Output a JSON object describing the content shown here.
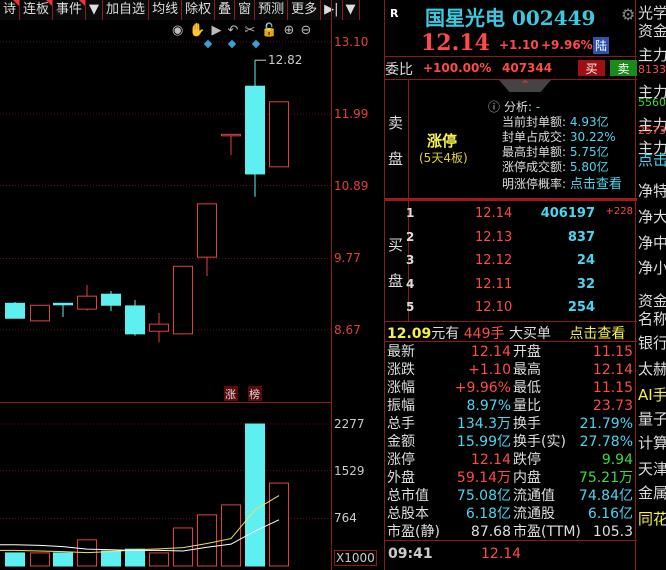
{
  "toolbar": {
    "items": [
      "诗",
      "连板",
      "事件",
      "▼",
      "加自选",
      "均线",
      "除权",
      "叠",
      "窗",
      "预测",
      "更多",
      "▶|",
      "▼"
    ]
  },
  "chart_tools": [
    "eye-icon",
    "hand-icon",
    "play-icon",
    "undo-icon",
    "scissors-icon",
    "lock-icon",
    "zoom-in-icon",
    "zoom-out-icon"
  ],
  "chart_data": [
    {
      "type": "candlestick",
      "title": "",
      "yticks": [
        "13.10",
        "11.99",
        "10.89",
        "9.77",
        "8.67"
      ],
      "ylim": [
        8.4,
        13.1
      ],
      "high_label": "12.82",
      "candles": [
        [
          9.08,
          9.1,
          8.85,
          8.85
        ],
        [
          8.81,
          9.05,
          8.8,
          9.05
        ],
        [
          9.08,
          9.08,
          8.87,
          9.08
        ],
        [
          8.99,
          9.36,
          8.97,
          9.19
        ],
        [
          9.22,
          9.27,
          8.96,
          9.05
        ],
        [
          9.04,
          9.13,
          8.58,
          8.61
        ],
        [
          8.65,
          8.93,
          8.48,
          8.76
        ],
        [
          8.61,
          9.65,
          8.6,
          9.65
        ],
        [
          9.79,
          10.61,
          9.5,
          10.61
        ],
        [
          11.68,
          11.68,
          11.36,
          11.68
        ],
        [
          12.42,
          12.82,
          10.72,
          11.07
        ],
        [
          11.18,
          12.18,
          11.18,
          12.18
        ]
      ],
      "markers": [
        "涨",
        "榜"
      ]
    },
    {
      "type": "bar",
      "title": "volume",
      "unit": "X1000",
      "yticks": [
        "2277",
        "1529",
        "764"
      ],
      "ylim": [
        0,
        2277
      ],
      "values": [
        210,
        210,
        210,
        420,
        240,
        270,
        210,
        610,
        820,
        980,
        2277,
        1330
      ],
      "up": [
        false,
        true,
        false,
        true,
        false,
        false,
        true,
        true,
        true,
        true,
        false,
        true
      ],
      "ma5": [
        250,
        240,
        230,
        215,
        230,
        260,
        275,
        295,
        360,
        440,
        900,
        1130
      ],
      "ma10": [
        340,
        330,
        310,
        270,
        260,
        250,
        250,
        240,
        300,
        350,
        560,
        740
      ]
    }
  ],
  "quote": {
    "badge": "R",
    "name": "国星光电 002449",
    "price": "12.14",
    "change": "+1.10",
    "pct": "+9.96%",
    "market": "陆",
    "weibi_label": "委比",
    "weibi": "+100.00%",
    "weicha": "407344",
    "buy": "买",
    "sell": "卖"
  },
  "sell_side": {
    "label1": "卖",
    "label2": "盘",
    "limit_up": "涨停",
    "streak": "(5天4板)",
    "analysis": [
      [
        "分析",
        "-"
      ],
      [
        "当前封单额",
        "4.93亿"
      ],
      [
        "封单占成交",
        "30.22%"
      ],
      [
        "最高封单额",
        "5.75亿"
      ],
      [
        "涨停成交额",
        "5.80亿"
      ],
      [
        "明涨停概率",
        "点击查看"
      ]
    ]
  },
  "buy_side": {
    "label1": "买",
    "label2": "盘",
    "rows": [
      [
        "1",
        "12.14",
        "406197",
        "+228"
      ],
      [
        "2",
        "12.13",
        "837",
        ""
      ],
      [
        "3",
        "12.12",
        "24",
        ""
      ],
      [
        "4",
        "12.11",
        "32",
        ""
      ],
      [
        "5",
        "12.10",
        "254",
        ""
      ]
    ]
  },
  "big_order": {
    "price": "12.09",
    "t1": "元有",
    "qty": "449手",
    "t2": "大买单",
    "link": "点击查看"
  },
  "stats": [
    [
      "最新",
      "12.14",
      "red",
      "开盘",
      "11.15",
      "red"
    ],
    [
      "涨跌",
      "+1.10",
      "red",
      "最高",
      "12.14",
      "red"
    ],
    [
      "涨幅",
      "+9.96%",
      "red",
      "最低",
      "11.15",
      "red"
    ],
    [
      "振幅",
      "8.97%",
      "cyan",
      "量比",
      "23.73",
      "red"
    ],
    [
      "总手",
      "134.3万",
      "cyan",
      "换手",
      "21.79%",
      "cyan"
    ],
    [
      "金额",
      "15.99亿",
      "cyan",
      "换手(实)",
      "27.78%",
      "cyan"
    ],
    [
      "涨停",
      "12.14",
      "red",
      "跌停",
      "9.94",
      "green"
    ],
    [
      "外盘",
      "59.14万",
      "red",
      "内盘",
      "75.21万",
      "green"
    ],
    [
      "总市值",
      "75.08亿",
      "cyan",
      "流通值",
      "74.84亿",
      "cyan"
    ],
    [
      "总股本",
      "6.18亿",
      "cyan",
      "流通股",
      "6.16亿",
      "cyan"
    ],
    [
      "市盈(静)",
      "87.68",
      "white",
      "市盈(TTM)",
      "105.3",
      "white"
    ]
  ],
  "tick": {
    "time": "09:41",
    "price": "12.14"
  },
  "far_right": [
    [
      "光学",
      "#ddd"
    ],
    [
      "资金",
      "#ddd"
    ],
    [
      "主力",
      "#ddd"
    ],
    [
      "8133",
      "#ff4a4a"
    ],
    [
      "主力",
      "#ddd"
    ],
    [
      "5560",
      "#3ddc3d"
    ],
    [
      "主力",
      "#ddd"
    ],
    [
      "2573",
      "#ff4a4a"
    ],
    [
      "主力",
      "#ddd"
    ],
    [
      "点击",
      "#4ad6f0"
    ],
    [
      "净特",
      "#ddd"
    ],
    [
      "净大",
      "#ddd"
    ],
    [
      "净中",
      "#ddd"
    ],
    [
      "净小",
      "#ddd"
    ],
    [
      "资金",
      "#ddd"
    ],
    [
      "名称",
      "#ddd"
    ],
    [
      "银行",
      "#ddd"
    ],
    [
      "太赫",
      "#ddd"
    ],
    [
      "AI手",
      "#f5f04a"
    ],
    [
      "量子",
      "#ddd"
    ],
    [
      "计算",
      "#ddd"
    ],
    [
      "天津",
      "#ddd"
    ],
    [
      "金属",
      "#ddd"
    ],
    [
      "同花",
      "#f5f04a"
    ]
  ]
}
